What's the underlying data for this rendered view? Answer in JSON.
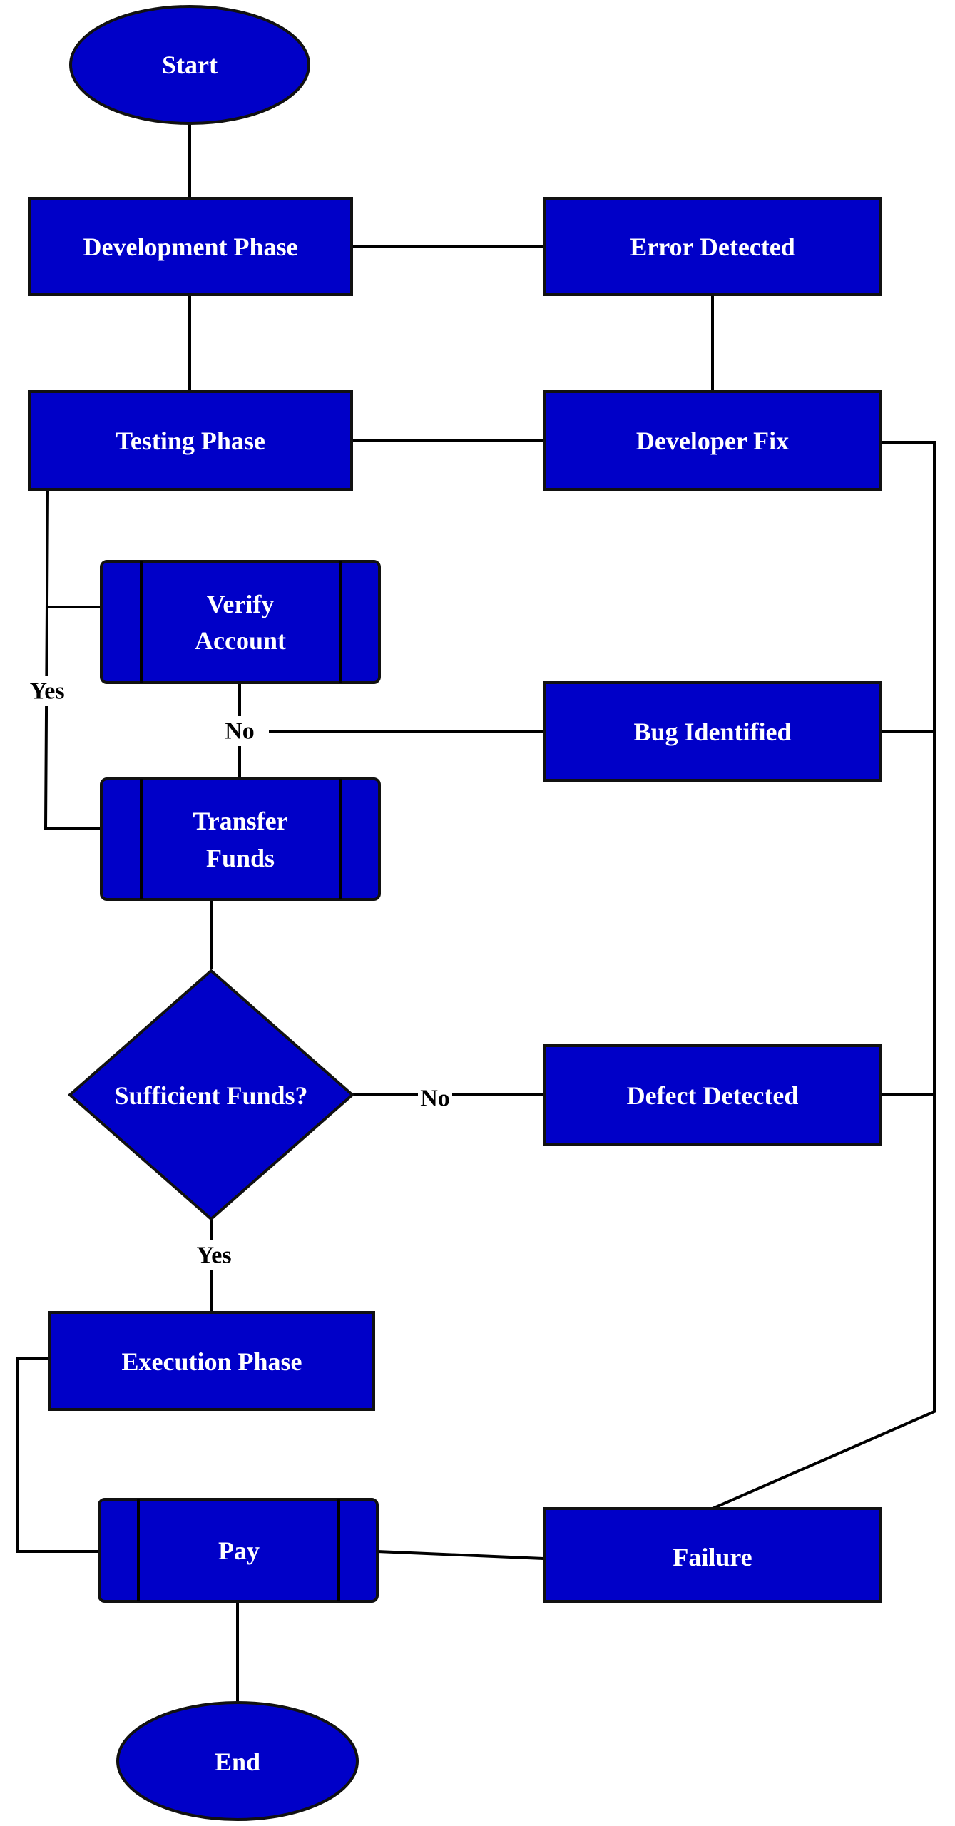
{
  "colors": {
    "node_fill": "#0000c8",
    "stroke": "#000000",
    "text": "#ffffff"
  },
  "nodes": {
    "start": "Start",
    "development": "Development Phase",
    "error": "Error Detected",
    "testing": "Testing Phase",
    "fix": "Developer Fix",
    "verify_1": "Verify",
    "verify_2": "Account",
    "bug": "Bug Identified",
    "transfer_1": "Transfer",
    "transfer_2": "Funds",
    "sufficient": "Sufficient Funds?",
    "defect": "Defect Detected",
    "execution": "Execution Phase",
    "pay": "Pay",
    "failure": "Failure",
    "end": "End"
  },
  "edge_labels": {
    "testing_yes": "Yes",
    "verify_no": "No",
    "funds_no": "No",
    "funds_yes": "Yes"
  }
}
